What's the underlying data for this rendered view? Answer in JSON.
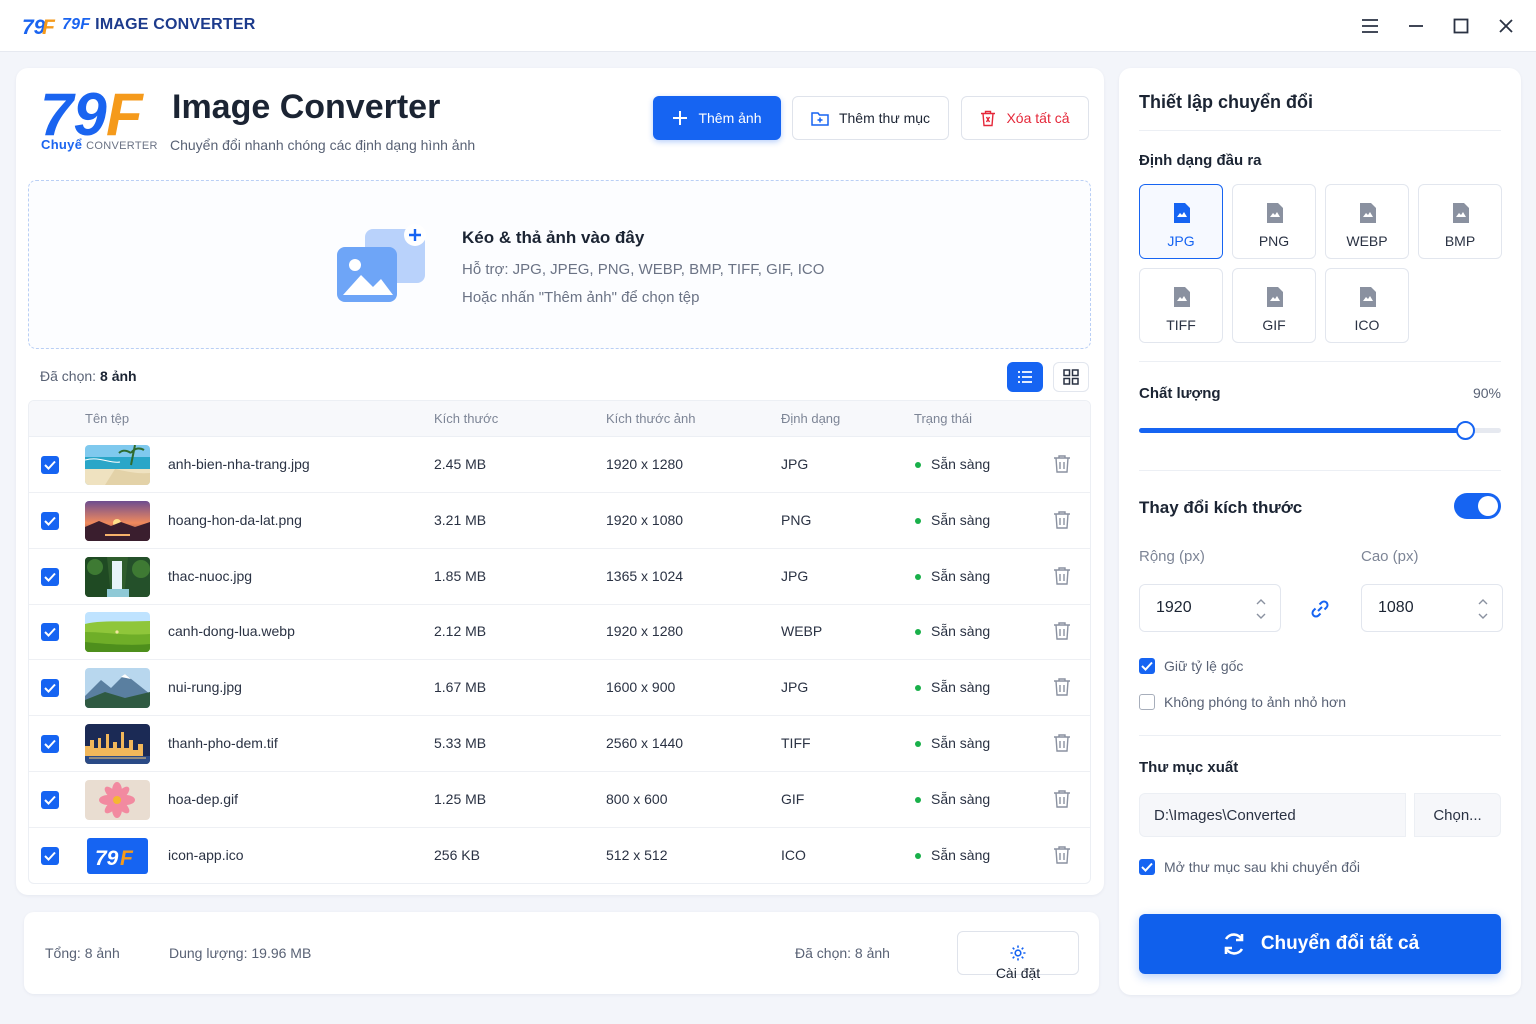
{
  "titlebar": {
    "brand_accent": "79F",
    "brand_text": "IMAGE CONVERTER"
  },
  "header": {
    "logo_text": "79F",
    "logo_sub_a": "Chuyể",
    "logo_sub_b": "CONVERTER",
    "title": "Image Converter",
    "subtitle": "Chuyển đổi nhanh chóng các định dạng hình ảnh",
    "add_images": "Thêm ảnh",
    "add_folder": "Thêm thư mục",
    "clear_all": "Xóa tất cả"
  },
  "dropzone": {
    "title": "Kéo & thả ảnh vào đây",
    "supported": "Hỗ trợ: JPG, JPEG, PNG, WEBP, BMP, TIFF, GIF, ICO",
    "hint": "Hoặc nhấn \"Thêm ảnh\" để chọn tệp"
  },
  "selection": {
    "label": "Đã chọn:",
    "value": "8 ảnh"
  },
  "table": {
    "headers": [
      "Tên tệp",
      "Kích thước",
      "Kích thước ảnh",
      "Định dạng",
      "Trạng thái"
    ],
    "rows": [
      {
        "name": "anh-bien-nha-trang.jpg",
        "size": "2.45 MB",
        "dims": "1920 x 1280",
        "format": "JPG",
        "status": "Sẵn sàng",
        "thumb": "beach"
      },
      {
        "name": "hoang-hon-da-lat.png",
        "size": "3.21 MB",
        "dims": "1920 x 1080",
        "format": "PNG",
        "status": "Sẵn sàng",
        "thumb": "sunset"
      },
      {
        "name": "thac-nuoc.jpg",
        "size": "1.85 MB",
        "dims": "1365 x 1024",
        "format": "JPG",
        "status": "Sẵn sàng",
        "thumb": "waterfall"
      },
      {
        "name": "canh-dong-lua.webp",
        "size": "2.12 MB",
        "dims": "1920 x 1280",
        "format": "WEBP",
        "status": "Sẵn sàng",
        "thumb": "field"
      },
      {
        "name": "nui-rung.jpg",
        "size": "1.67 MB",
        "dims": "1600 x 900",
        "format": "JPG",
        "status": "Sẵn sàng",
        "thumb": "mountain"
      },
      {
        "name": "thanh-pho-dem.tif",
        "size": "5.33 MB",
        "dims": "2560 x 1440",
        "format": "TIFF",
        "status": "Sẵn sàng",
        "thumb": "city"
      },
      {
        "name": "hoa-dep.gif",
        "size": "1.25 MB",
        "dims": "800 x 600",
        "format": "GIF",
        "status": "Sẵn sàng",
        "thumb": "flower"
      },
      {
        "name": "icon-app.ico",
        "size": "256 KB",
        "dims": "512 x 512",
        "format": "ICO",
        "status": "Sẵn sàng",
        "thumb": "logo"
      }
    ]
  },
  "summary": {
    "total": "Tổng: 8 ảnh",
    "capacity": "Dung lượng: 19.96 MB",
    "selected": "Đã chọn: 8 ảnh",
    "settings": "Cài đặt"
  },
  "settings": {
    "title": "Thiết lập chuyển đổi",
    "output_label": "Định dạng đầu ra",
    "formats": [
      "JPG",
      "PNG",
      "WEBP",
      "BMP",
      "TIFF",
      "GIF",
      "ICO"
    ],
    "selected_format": "JPG",
    "quality_label": "Chất lượng",
    "quality_value": "90%",
    "quality_fraction": 0.9,
    "resize_label": "Thay đổi kích thước",
    "resize_enabled": true,
    "width_label": "Rộng (px)",
    "height_label": "Cao (px)",
    "width": "1920",
    "height": "1080",
    "keep_ratio": "Giữ tỷ lệ gốc",
    "keep_ratio_checked": true,
    "no_upscale": "Không phóng to ảnh nhỏ hơn",
    "no_upscale_checked": false,
    "output_dir_label": "Thư mục xuất",
    "output_dir": "D:\\Images\\Converted",
    "choose": "Chọn...",
    "open_after": "Mở thư mục sau khi chuyển đổi",
    "open_after_checked": true,
    "convert_all": "Chuyển đổi tất cả"
  },
  "colors": {
    "primary": "#1664f2",
    "danger": "#e5283a",
    "success": "#19b04a",
    "logo_orange": "#f59a1b"
  }
}
